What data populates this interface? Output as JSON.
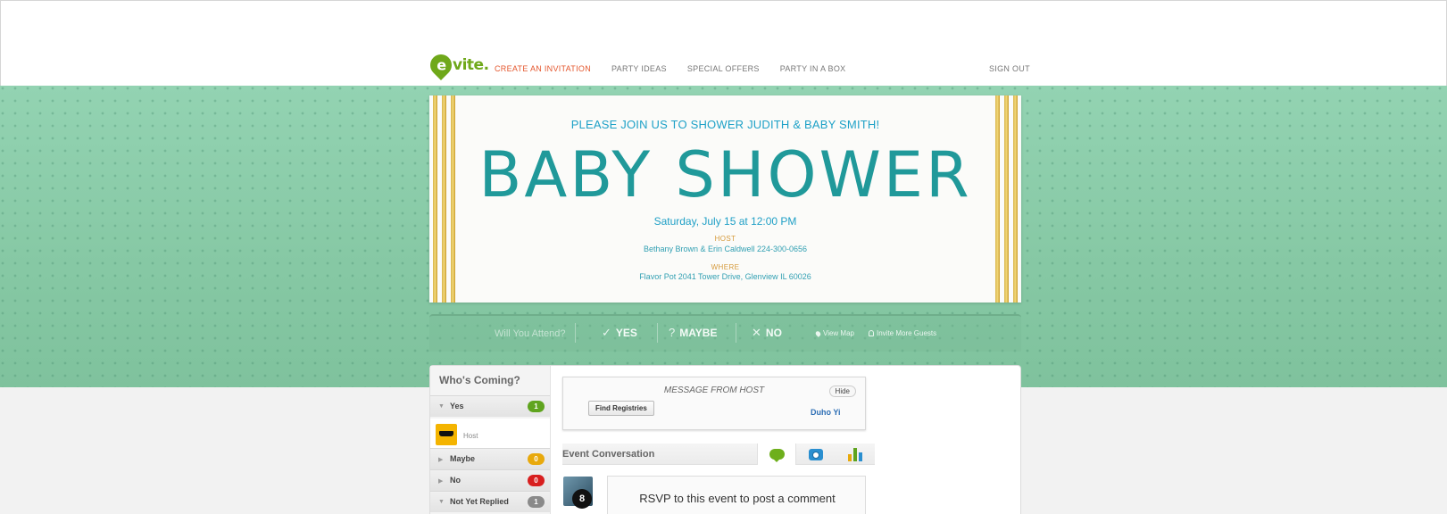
{
  "header": {
    "logo_text": "vite.",
    "logo_letter": "e",
    "nav": [
      {
        "label": "CREATE AN INVITATION"
      },
      {
        "label": "PARTY IDEAS"
      },
      {
        "label": "SPECIAL OFFERS"
      },
      {
        "label": "PARTY IN A BOX"
      }
    ],
    "signout": "SIGN OUT"
  },
  "invitation": {
    "subtitle": "PLEASE JOIN US TO SHOWER JUDITH & BABY SMITH!",
    "title": "BABY SHOWER",
    "date": "Saturday, July 15 at 12:00 PM",
    "host_label": "HOST",
    "host_value": "Bethany Brown & Erin Caldwell 224-300-0656",
    "where_label": "WHERE",
    "where_value": "Flavor Pot 2041 Tower Drive, Glenview IL 60026"
  },
  "rsvp": {
    "question": "Will You Attend?",
    "yes": "YES",
    "maybe": "MAYBE",
    "no": "NO",
    "yes_icon": "✓",
    "maybe_icon": "?",
    "no_icon": "✕",
    "view_map": "View Map",
    "invite_more": "Invite More Guests"
  },
  "guests": {
    "title": "Who's Coming?",
    "groups": [
      {
        "label": "Yes",
        "count": "1",
        "color": "#5fa41e"
      },
      {
        "label": "Maybe",
        "count": "0",
        "color": "#e8a90c"
      },
      {
        "label": "No",
        "count": "0",
        "color": "#d81f1f"
      },
      {
        "label": "Not Yet Replied",
        "count": "1",
        "color": "#8a8a8a"
      }
    ],
    "host_label": "Host"
  },
  "message": {
    "heading": "MESSAGE FROM HOST",
    "hide": "Hide",
    "find_registries": "Find Registries",
    "host_name": "Duho Yi"
  },
  "conversation": {
    "title": "Event Conversation",
    "tabs": [
      "chat-icon",
      "camera-icon",
      "poll-icon"
    ],
    "rsvp_prompt": "RSVP to this event to post a comment",
    "avatar_number": "8"
  }
}
